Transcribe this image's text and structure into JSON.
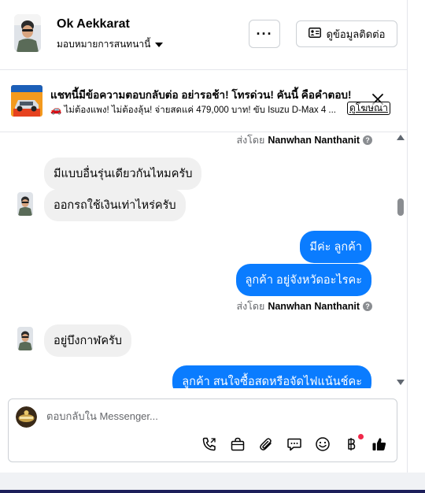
{
  "header": {
    "name": "Ok Aekkarat",
    "assign_label": "มอบหมายการสนทนานี้",
    "more_label": "···",
    "contact_button": "ดูข้อมูลติดต่อ"
  },
  "ad": {
    "title": "แชทนี้มีข้อความตอบกลับต่อ อย่ารอช้า! โทรด่วน! คันนี้ คือคำตอบ!",
    "text": "🚗 ไม่ต้องแพง! ไม่ต้องลุ้น! จ่ายสดแค่ 479,000 บาท! ขับ Isuzu D-Max 4 ...",
    "label": "ดูโฆษณา",
    "close_icon": "close-icon"
  },
  "messages": [
    {
      "type": "sentby",
      "prefix": "ส่งโดย",
      "name": "Nanwhan Nanthanit"
    },
    {
      "type": "in",
      "text": "มีแบบอื่นรุ่นเดียวกันไหมครับ"
    },
    {
      "type": "in",
      "text": "ออกรถใช้เงินเท่าไหร่ครับ"
    },
    {
      "type": "out",
      "text": "มีค่ะ  ลูกค้า"
    },
    {
      "type": "out",
      "text": "ลูกค้า   อยู่จังหวัดอะไรคะ"
    },
    {
      "type": "sentby",
      "prefix": "ส่งโดย",
      "name": "Nanwhan Nanthanit"
    },
    {
      "type": "in",
      "text": "อยู่บึงกาฬครับ"
    },
    {
      "type": "out",
      "text": "ลูกค้า สนใจซื้อสดหรือจัดไฟแน้นช์คะ"
    }
  ],
  "composer": {
    "placeholder": "ตอบกลับใน Messenger...",
    "tools": [
      "phone-icon",
      "shopping-bag-icon",
      "paperclip-icon",
      "chat-bubble-icon",
      "emoji-icon",
      "baht-icon",
      "thumbs-up-icon"
    ]
  },
  "colors": {
    "accent": "#0a7cff",
    "incoming_bubble": "#f0f0f0",
    "notification": "#f02849"
  }
}
